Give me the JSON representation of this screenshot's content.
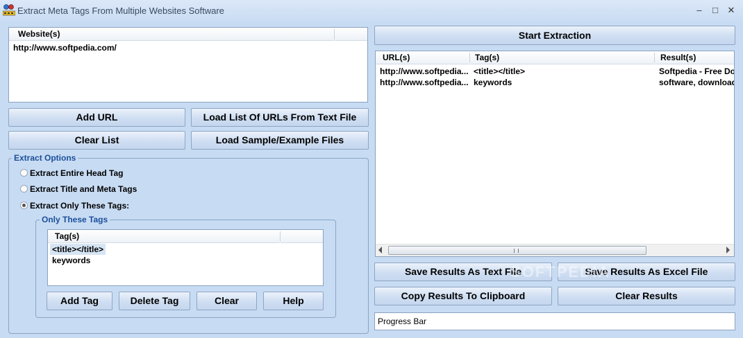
{
  "window": {
    "title": "Extract Meta Tags From Multiple Websites Software",
    "minimize": "–",
    "maximize": "□",
    "close": "✕"
  },
  "websites": {
    "header": "Website(s)",
    "items": [
      "http://www.softpedia.com/"
    ]
  },
  "buttons": {
    "add_url": "Add URL",
    "load_list": "Load List Of URLs From Text File",
    "clear_list": "Clear List",
    "load_sample": "Load Sample/Example Files",
    "start": "Start Extraction",
    "save_text": "Save Results As Text File",
    "save_excel": "Save Results As Excel File",
    "copy_clipboard": "Copy Results To Clipboard",
    "clear_results": "Clear Results",
    "add_tag": "Add Tag",
    "delete_tag": "Delete Tag",
    "clear_tags": "Clear",
    "help": "Help"
  },
  "extract_options": {
    "legend": "Extract Options",
    "options": [
      "Extract Entire Head Tag",
      "Extract Title and Meta Tags",
      "Extract Only These Tags:"
    ],
    "selected_index": 2
  },
  "only_tags": {
    "legend": "Only These Tags",
    "header": "Tag(s)",
    "items": [
      "<title></title>",
      "keywords"
    ]
  },
  "results": {
    "columns": [
      "URL(s)",
      "Tag(s)",
      "Result(s)"
    ],
    "rows": [
      [
        "http://www.softpedia...",
        "<title></title>",
        "Softpedia - Free Dow"
      ],
      [
        "http://www.softpedia...",
        "keywords",
        "software, download"
      ]
    ]
  },
  "progress": {
    "label": "Progress Bar"
  },
  "watermark": "SOFTPEDIA"
}
